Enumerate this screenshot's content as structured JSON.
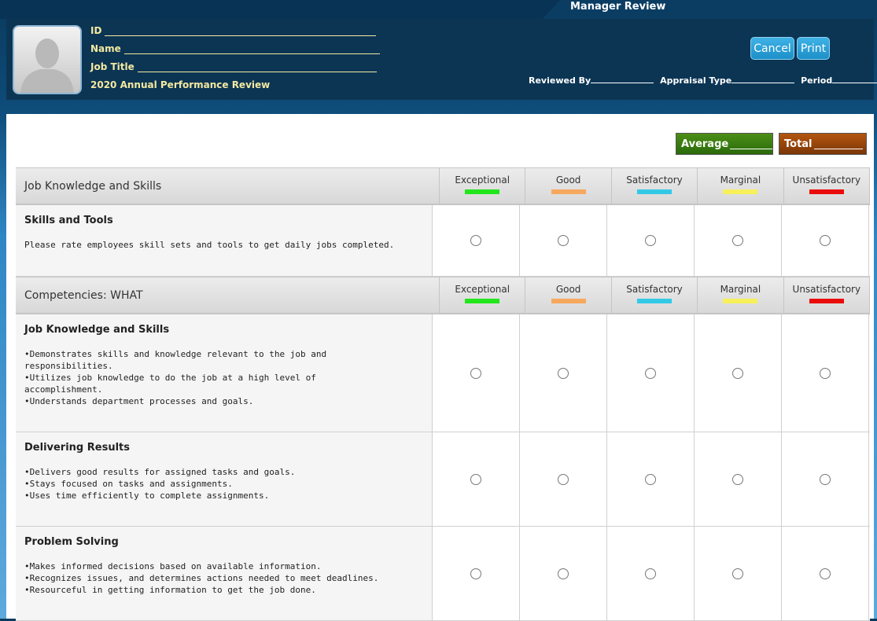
{
  "window": {
    "title": "Manager Review"
  },
  "profile": {
    "id_label": "ID",
    "name_label": "Name",
    "job_title_label": "Job Title",
    "review_title": "2020 Annual Performance Review"
  },
  "actions": {
    "cancel": "Cancel",
    "print": "Print"
  },
  "review_meta": {
    "reviewed_by": "Reviewed By",
    "appraisal_type": "Appraisal Type",
    "period": "Period"
  },
  "summary": {
    "average": "Average",
    "total": "Total"
  },
  "ratings": [
    {
      "label": "Exceptional",
      "color": "#22e61b"
    },
    {
      "label": "Good",
      "color": "#f7a85f"
    },
    {
      "label": "Satisfactory",
      "color": "#33c9e6"
    },
    {
      "label": "Marginal",
      "color": "#f7f05a"
    },
    {
      "label": "Unsatisfactory",
      "color": "#ea0b0b"
    }
  ],
  "sections": [
    {
      "title": "Job Knowledge and Skills",
      "items": [
        {
          "title": "Skills and Tools",
          "text": "Please rate employees skill sets and tools to get daily jobs completed."
        }
      ]
    },
    {
      "title": "Competencies: WHAT",
      "items": [
        {
          "title": "Job Knowledge and Skills",
          "text": "•Demonstrates skills and knowledge relevant to the job and\nresponsibilities.\n•Utilizes job knowledge to do the job at a high level of\naccomplishment.\n•Understands department processes and goals."
        },
        {
          "title": "Delivering Results",
          "text": "•Delivers good results for assigned tasks and goals.\n•Stays focused on tasks and assignments.\n•Uses time efficiently to complete assignments."
        },
        {
          "title": "Problem Solving",
          "text": "•Makes informed decisions based on available information.\n•Recognizes issues, and determines actions needed to meet deadlines.\n•Resourceful in getting information to get the job done."
        }
      ]
    }
  ]
}
